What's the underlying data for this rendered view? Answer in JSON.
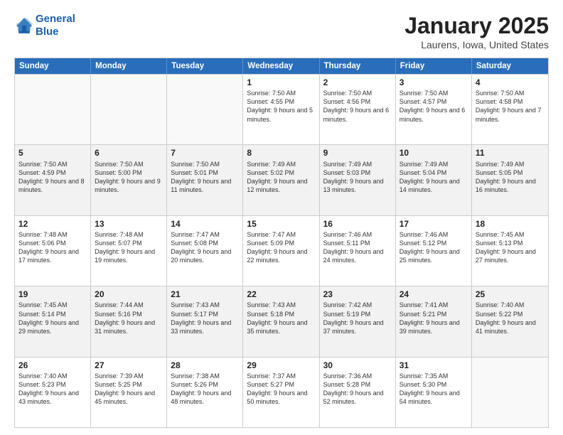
{
  "logo": {
    "line1": "General",
    "line2": "Blue"
  },
  "title": "January 2025",
  "subtitle": "Laurens, Iowa, United States",
  "headers": [
    "Sunday",
    "Monday",
    "Tuesday",
    "Wednesday",
    "Thursday",
    "Friday",
    "Saturday"
  ],
  "weeks": [
    [
      {
        "day": "",
        "info": "",
        "shaded": false,
        "empty": true
      },
      {
        "day": "",
        "info": "",
        "shaded": false,
        "empty": true
      },
      {
        "day": "",
        "info": "",
        "shaded": false,
        "empty": true
      },
      {
        "day": "1",
        "info": "Sunrise: 7:50 AM\nSunset: 4:55 PM\nDaylight: 9 hours\nand 5 minutes.",
        "shaded": false,
        "empty": false
      },
      {
        "day": "2",
        "info": "Sunrise: 7:50 AM\nSunset: 4:56 PM\nDaylight: 9 hours\nand 6 minutes.",
        "shaded": false,
        "empty": false
      },
      {
        "day": "3",
        "info": "Sunrise: 7:50 AM\nSunset: 4:57 PM\nDaylight: 9 hours\nand 6 minutes.",
        "shaded": false,
        "empty": false
      },
      {
        "day": "4",
        "info": "Sunrise: 7:50 AM\nSunset: 4:58 PM\nDaylight: 9 hours\nand 7 minutes.",
        "shaded": false,
        "empty": false
      }
    ],
    [
      {
        "day": "5",
        "info": "Sunrise: 7:50 AM\nSunset: 4:59 PM\nDaylight: 9 hours\nand 8 minutes.",
        "shaded": true,
        "empty": false
      },
      {
        "day": "6",
        "info": "Sunrise: 7:50 AM\nSunset: 5:00 PM\nDaylight: 9 hours\nand 9 minutes.",
        "shaded": true,
        "empty": false
      },
      {
        "day": "7",
        "info": "Sunrise: 7:50 AM\nSunset: 5:01 PM\nDaylight: 9 hours\nand 11 minutes.",
        "shaded": true,
        "empty": false
      },
      {
        "day": "8",
        "info": "Sunrise: 7:49 AM\nSunset: 5:02 PM\nDaylight: 9 hours\nand 12 minutes.",
        "shaded": true,
        "empty": false
      },
      {
        "day": "9",
        "info": "Sunrise: 7:49 AM\nSunset: 5:03 PM\nDaylight: 9 hours\nand 13 minutes.",
        "shaded": true,
        "empty": false
      },
      {
        "day": "10",
        "info": "Sunrise: 7:49 AM\nSunset: 5:04 PM\nDaylight: 9 hours\nand 14 minutes.",
        "shaded": true,
        "empty": false
      },
      {
        "day": "11",
        "info": "Sunrise: 7:49 AM\nSunset: 5:05 PM\nDaylight: 9 hours\nand 16 minutes.",
        "shaded": true,
        "empty": false
      }
    ],
    [
      {
        "day": "12",
        "info": "Sunrise: 7:48 AM\nSunset: 5:06 PM\nDaylight: 9 hours\nand 17 minutes.",
        "shaded": false,
        "empty": false
      },
      {
        "day": "13",
        "info": "Sunrise: 7:48 AM\nSunset: 5:07 PM\nDaylight: 9 hours\nand 19 minutes.",
        "shaded": false,
        "empty": false
      },
      {
        "day": "14",
        "info": "Sunrise: 7:47 AM\nSunset: 5:08 PM\nDaylight: 9 hours\nand 20 minutes.",
        "shaded": false,
        "empty": false
      },
      {
        "day": "15",
        "info": "Sunrise: 7:47 AM\nSunset: 5:09 PM\nDaylight: 9 hours\nand 22 minutes.",
        "shaded": false,
        "empty": false
      },
      {
        "day": "16",
        "info": "Sunrise: 7:46 AM\nSunset: 5:11 PM\nDaylight: 9 hours\nand 24 minutes.",
        "shaded": false,
        "empty": false
      },
      {
        "day": "17",
        "info": "Sunrise: 7:46 AM\nSunset: 5:12 PM\nDaylight: 9 hours\nand 25 minutes.",
        "shaded": false,
        "empty": false
      },
      {
        "day": "18",
        "info": "Sunrise: 7:45 AM\nSunset: 5:13 PM\nDaylight: 9 hours\nand 27 minutes.",
        "shaded": false,
        "empty": false
      }
    ],
    [
      {
        "day": "19",
        "info": "Sunrise: 7:45 AM\nSunset: 5:14 PM\nDaylight: 9 hours\nand 29 minutes.",
        "shaded": true,
        "empty": false
      },
      {
        "day": "20",
        "info": "Sunrise: 7:44 AM\nSunset: 5:16 PM\nDaylight: 9 hours\nand 31 minutes.",
        "shaded": true,
        "empty": false
      },
      {
        "day": "21",
        "info": "Sunrise: 7:43 AM\nSunset: 5:17 PM\nDaylight: 9 hours\nand 33 minutes.",
        "shaded": true,
        "empty": false
      },
      {
        "day": "22",
        "info": "Sunrise: 7:43 AM\nSunset: 5:18 PM\nDaylight: 9 hours\nand 35 minutes.",
        "shaded": true,
        "empty": false
      },
      {
        "day": "23",
        "info": "Sunrise: 7:42 AM\nSunset: 5:19 PM\nDaylight: 9 hours\nand 37 minutes.",
        "shaded": true,
        "empty": false
      },
      {
        "day": "24",
        "info": "Sunrise: 7:41 AM\nSunset: 5:21 PM\nDaylight: 9 hours\nand 39 minutes.",
        "shaded": true,
        "empty": false
      },
      {
        "day": "25",
        "info": "Sunrise: 7:40 AM\nSunset: 5:22 PM\nDaylight: 9 hours\nand 41 minutes.",
        "shaded": true,
        "empty": false
      }
    ],
    [
      {
        "day": "26",
        "info": "Sunrise: 7:40 AM\nSunset: 5:23 PM\nDaylight: 9 hours\nand 43 minutes.",
        "shaded": false,
        "empty": false
      },
      {
        "day": "27",
        "info": "Sunrise: 7:39 AM\nSunset: 5:25 PM\nDaylight: 9 hours\nand 45 minutes.",
        "shaded": false,
        "empty": false
      },
      {
        "day": "28",
        "info": "Sunrise: 7:38 AM\nSunset: 5:26 PM\nDaylight: 9 hours\nand 48 minutes.",
        "shaded": false,
        "empty": false
      },
      {
        "day": "29",
        "info": "Sunrise: 7:37 AM\nSunset: 5:27 PM\nDaylight: 9 hours\nand 50 minutes.",
        "shaded": false,
        "empty": false
      },
      {
        "day": "30",
        "info": "Sunrise: 7:36 AM\nSunset: 5:28 PM\nDaylight: 9 hours\nand 52 minutes.",
        "shaded": false,
        "empty": false
      },
      {
        "day": "31",
        "info": "Sunrise: 7:35 AM\nSunset: 5:30 PM\nDaylight: 9 hours\nand 54 minutes.",
        "shaded": false,
        "empty": false
      },
      {
        "day": "",
        "info": "",
        "shaded": false,
        "empty": true
      }
    ]
  ]
}
